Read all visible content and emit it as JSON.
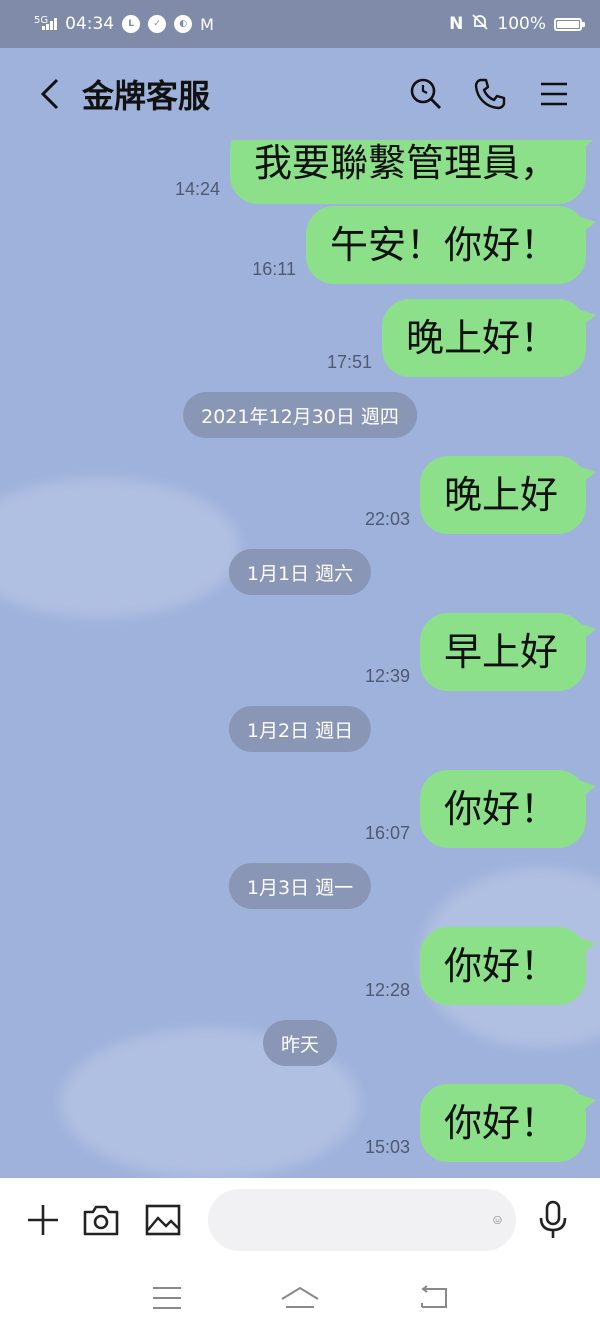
{
  "status_bar": {
    "network": "5G",
    "time": "04:34",
    "battery": "100%"
  },
  "header": {
    "title": "金牌客服"
  },
  "messages": [
    {
      "type": "out",
      "text": "我要聯繫管理員，",
      "time": "14:24"
    },
    {
      "type": "out",
      "text": "午安！你好！",
      "time": "16:11"
    },
    {
      "type": "out",
      "text": "晚上好！",
      "time": "17:51"
    },
    {
      "type": "date",
      "text": "2021年12月30日 週四"
    },
    {
      "type": "out",
      "text": "晚上好",
      "time": "22:03"
    },
    {
      "type": "date",
      "text": "1月1日 週六"
    },
    {
      "type": "out",
      "text": "早上好",
      "time": "12:39"
    },
    {
      "type": "date",
      "text": "1月2日 週日"
    },
    {
      "type": "out",
      "text": "你好！",
      "time": "16:07"
    },
    {
      "type": "date",
      "text": "1月3日 週一"
    },
    {
      "type": "out",
      "text": "你好！",
      "time": "12:28"
    },
    {
      "type": "date",
      "text": "昨天"
    },
    {
      "type": "out",
      "text": "你好！",
      "time": "15:03"
    }
  ],
  "input": {
    "placeholder": ""
  },
  "colors": {
    "chat_background": "#9fb2dc",
    "outgoing_bubble": "#8de08a",
    "date_pill": "#8a96b5",
    "status_bar": "#7f8ba8"
  }
}
